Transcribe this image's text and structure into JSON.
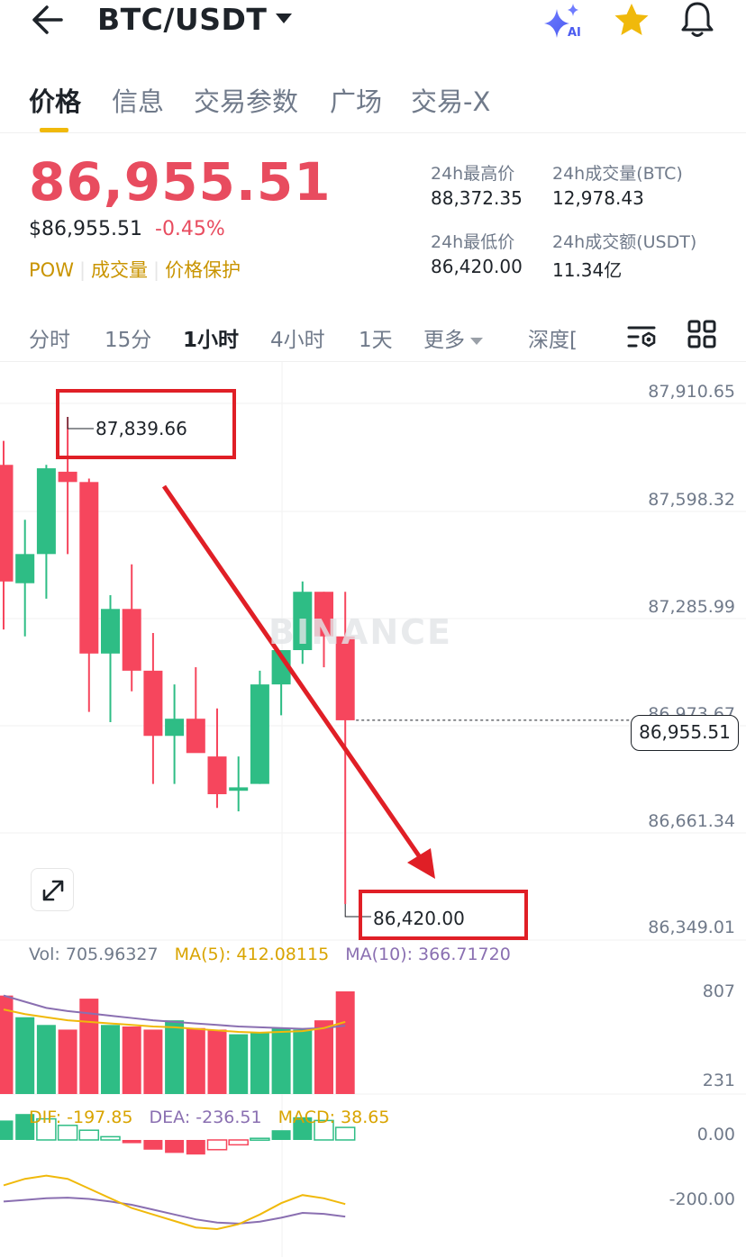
{
  "header": {
    "pair": "BTC/USDT",
    "icons": [
      "back-arrow-icon",
      "caret-down-icon",
      "ai-sparkle-icon",
      "favorite-star-icon",
      "bell-icon"
    ]
  },
  "tabs": [
    {
      "label": "价格",
      "active": true
    },
    {
      "label": "信息"
    },
    {
      "label": "交易参数"
    },
    {
      "label": "广场"
    },
    {
      "label": "交易-X"
    }
  ],
  "price": {
    "last": "86,955.51",
    "usd": "$86,955.51",
    "change": "-0.45%",
    "tags": [
      "POW",
      "成交量",
      "价格保护"
    ]
  },
  "stats": {
    "high_label": "24h最高价",
    "high_value": "88,372.35",
    "vol_btc_label": "24h成交量(BTC)",
    "vol_btc_value": "12,978.43",
    "low_label": "24h最低价",
    "low_value": "86,420.00",
    "vol_usdt_label": "24h成交额(USDT)",
    "vol_usdt_value": "11.34亿"
  },
  "intervals": [
    "分时",
    "15分",
    "1小时",
    "4小时",
    "1天",
    "更多",
    "深度["
  ],
  "active_interval": "1小时",
  "chart": {
    "price_axis": [
      "87,910.65",
      "87,598.32",
      "87,285.99",
      "86,973.67",
      "86,661.34",
      "86,349.01"
    ],
    "last_price_label": "86,955.51",
    "high_annotation": "87,839.66",
    "low_annotation": "86,420.00",
    "watermark": "BINANCE",
    "volume_axis": [
      "807",
      "231"
    ],
    "macd_axis": [
      "0.00",
      "-200.00"
    ],
    "indicators": {
      "vol": "Vol: 705.96327",
      "ma5": "MA(5): 412.08115",
      "ma10": "MA(10): 366.71720",
      "dif": "DIF: -197.85",
      "dea": "DEA: -236.51",
      "macd": "MACD: 38.65"
    },
    "colors": {
      "up": "#2ebd85",
      "down": "#f6465d",
      "accent": "#f0b90b",
      "annotation": "#e01f26",
      "ma10": "#8a6fb1"
    }
  },
  "chart_data": {
    "type": "candlestick",
    "y_range": [
      86349.01,
      87910.65
    ],
    "candles": [
      {
        "open": 87700,
        "high": 87770,
        "low": 87220,
        "close": 87360
      },
      {
        "open": 87355,
        "high": 87540,
        "low": 87200,
        "close": 87440
      },
      {
        "open": 87440,
        "high": 87700,
        "low": 87310,
        "close": 87690
      },
      {
        "open": 87680,
        "high": 87839.66,
        "low": 87440,
        "close": 87650
      },
      {
        "open": 87650,
        "high": 87660,
        "low": 86980,
        "close": 87150
      },
      {
        "open": 87150,
        "high": 87320,
        "low": 86950,
        "close": 87280
      },
      {
        "open": 87280,
        "high": 87410,
        "low": 87040,
        "close": 87100
      },
      {
        "open": 87100,
        "high": 87210,
        "low": 86770,
        "close": 86910
      },
      {
        "open": 86910,
        "high": 87060,
        "low": 86770,
        "close": 86960
      },
      {
        "open": 86960,
        "high": 87110,
        "low": 86870,
        "close": 86860
      },
      {
        "open": 86850,
        "high": 86990,
        "low": 86700,
        "close": 86740
      },
      {
        "open": 86750,
        "high": 86850,
        "low": 86690,
        "close": 86760
      },
      {
        "open": 86770,
        "high": 87100,
        "low": 86770,
        "close": 87060
      },
      {
        "open": 87060,
        "high": 87160,
        "low": 86970,
        "close": 87160
      },
      {
        "open": 87160,
        "high": 87360,
        "low": 87120,
        "close": 87330
      },
      {
        "open": 87330,
        "high": 87330,
        "low": 87110,
        "close": 87200
      },
      {
        "open": 87200,
        "high": 87330,
        "low": 86420.0,
        "close": 86955.51
      }
    ],
    "volume": [
      780,
      640,
      590,
      560,
      760,
      590,
      580,
      560,
      620,
      570,
      560,
      530,
      540,
      570,
      560,
      620,
      807
    ],
    "ma5": [
      690,
      660,
      640,
      620,
      610,
      600,
      590,
      580,
      575,
      565,
      555,
      545,
      540,
      545,
      550,
      570,
      610
    ],
    "ma10": [
      780,
      740,
      700,
      680,
      665,
      650,
      635,
      620,
      610,
      600,
      590,
      580,
      575,
      570,
      565,
      570,
      585
    ],
    "macd_hist": [
      60,
      80,
      65,
      45,
      30,
      10,
      -10,
      -30,
      -40,
      -45,
      -30,
      -15,
      5,
      30,
      70,
      60,
      38.65
    ],
    "dif": [
      -140,
      -120,
      -110,
      -120,
      -150,
      -180,
      -210,
      -230,
      -250,
      -270,
      -275,
      -260,
      -230,
      -195,
      -170,
      -180,
      -197.85
    ],
    "dea": [
      -190,
      -185,
      -180,
      -178,
      -182,
      -190,
      -200,
      -215,
      -230,
      -245,
      -255,
      -258,
      -252,
      -240,
      -225,
      -228,
      -236.51
    ]
  }
}
